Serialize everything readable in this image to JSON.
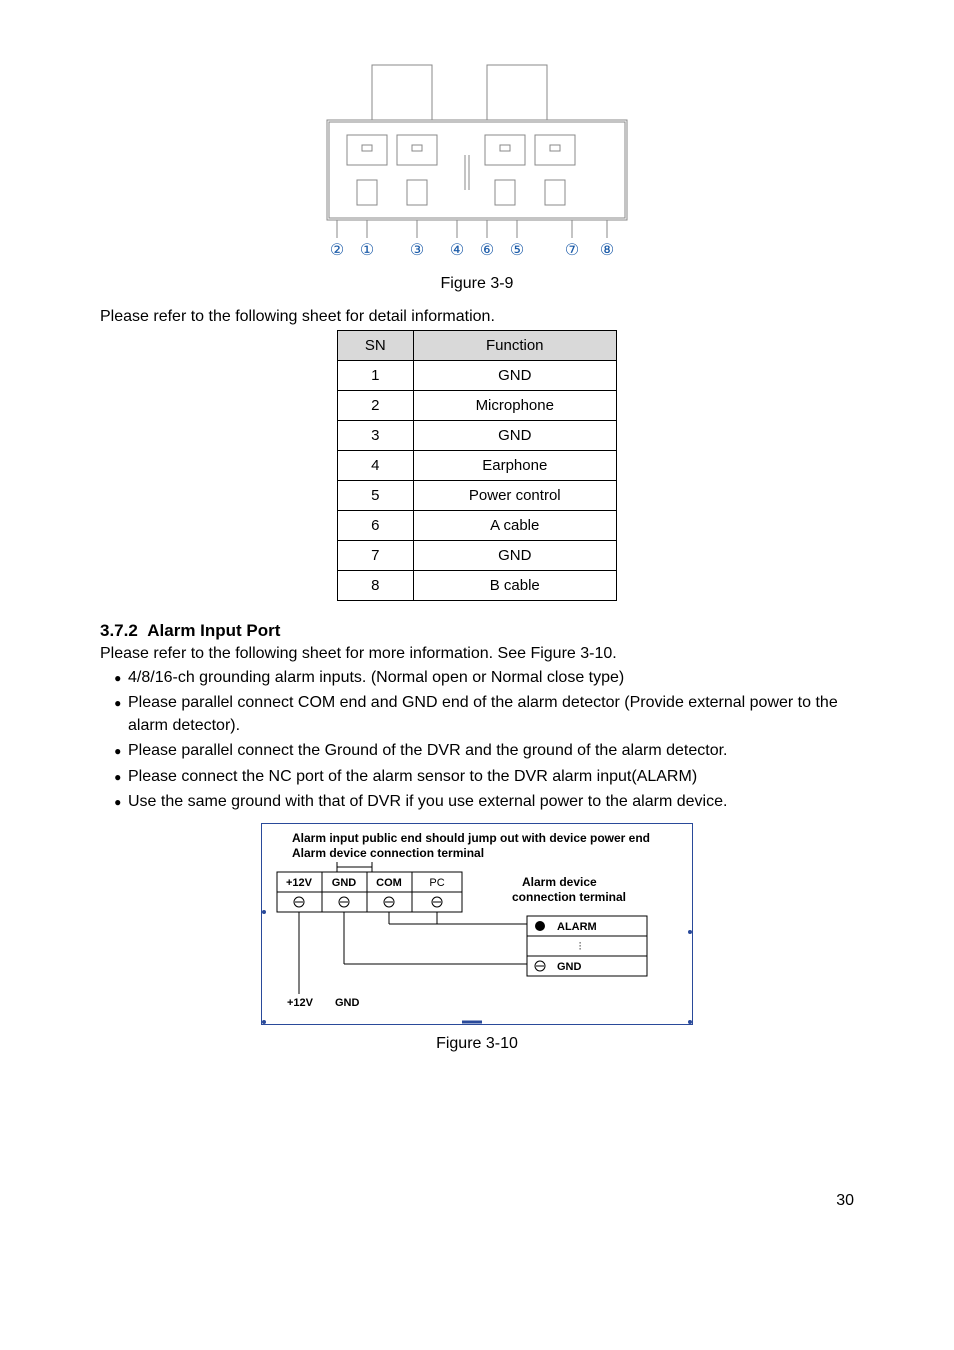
{
  "figure_top_caption": "Figure 3-9",
  "intro_top": "Please refer to the following sheet for detail information.",
  "table": {
    "headers": [
      "SN",
      "Function"
    ],
    "rows": [
      [
        "1",
        "GND"
      ],
      [
        "2",
        "Microphone"
      ],
      [
        "3",
        "GND"
      ],
      [
        "4",
        "Earphone"
      ],
      [
        "5",
        "Power control"
      ],
      [
        "6",
        "A cable"
      ],
      [
        "7",
        "GND"
      ],
      [
        "8",
        "B cable"
      ]
    ]
  },
  "section_number": "3.7.2",
  "section_title": "Alarm Input Port",
  "section_intro": "Please refer to the following sheet for more information. See Figure 3-10.",
  "bullets": [
    "4/8/16-ch grounding alarm inputs. (Normal open or Normal close type)",
    "Please parallel connect COM end and GND end of the alarm detector (Provide external power to the alarm detector).",
    "Please parallel connect the Ground of the DVR and the ground of the alarm detector.",
    "Please connect the NC port of the alarm sensor to the DVR alarm input(ALARM)",
    "Use the same ground with that of DVR if you use external power to the alarm device."
  ],
  "figure_bottom_caption": "Figure 3-10",
  "page_number": "30",
  "circled_labels": [
    "②",
    "①",
    "③",
    "④",
    "⑥",
    "⑤",
    "⑦",
    "⑧"
  ],
  "alarm_diagram": {
    "top_text1": "Alarm input public end should jump out with device power end",
    "top_text2": "Alarm device connection terminal",
    "cols": [
      "+12V",
      "GND",
      "COM",
      "PC"
    ],
    "right_text1": "Alarm device",
    "right_text2": "connection terminal",
    "alarm_label": "ALARM",
    "gnd_label": "GND",
    "bottom_left": "+12V",
    "bottom_mid": "GND"
  }
}
